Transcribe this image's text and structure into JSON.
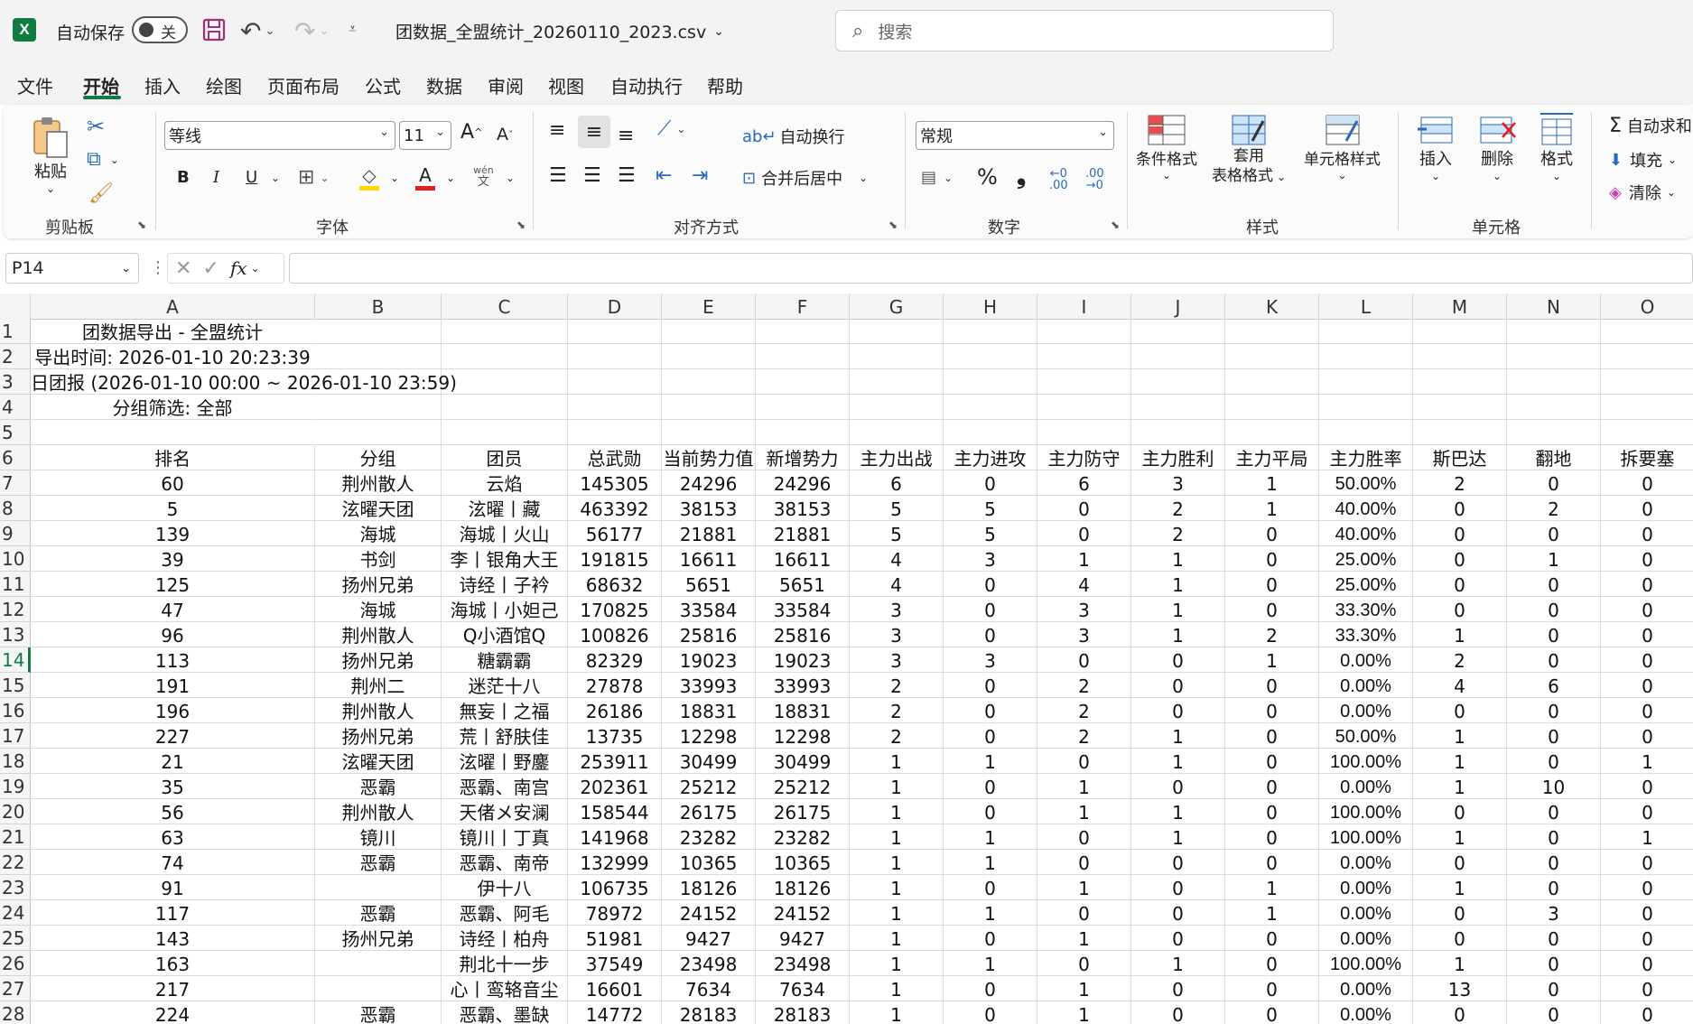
{
  "titlebar": {
    "app_icon": "X",
    "autosave_label": "自动保存",
    "autosave_state": "关",
    "filename": "团数据_全盟统计_20260110_2023.csv",
    "search_placeholder": "搜索"
  },
  "menu_tabs": [
    "文件",
    "开始",
    "插入",
    "绘图",
    "页面布局",
    "公式",
    "数据",
    "审阅",
    "视图",
    "自动执行",
    "帮助"
  ],
  "active_tab": "开始",
  "ribbon": {
    "clipboard": {
      "paste": "粘贴",
      "label": "剪贴板"
    },
    "font": {
      "name": "等线",
      "size": "11",
      "bold": "B",
      "italic": "I",
      "underline": "U",
      "wen": "wén",
      "wen2": "文",
      "label": "字体",
      "highlight_color": "#ffd700",
      "font_color": "#e02020"
    },
    "alignment": {
      "wrap": "自动换行",
      "merge": "合并后居中",
      "label": "对齐方式"
    },
    "number": {
      "format": "常规",
      "percent": "%",
      "comma": "❟",
      "label": "数字"
    },
    "styles": {
      "conditional": "条件格式",
      "table1": "套用",
      "table2": "表格格式",
      "cell_styles": "单元格样式",
      "label": "样式"
    },
    "cells": {
      "insert": "插入",
      "delete": "删除",
      "format": "格式",
      "label": "单元格"
    },
    "editing": {
      "autosum": "自动求和",
      "fill": "填充",
      "clear": "清除"
    }
  },
  "formula_bar": {
    "name_box": "P14",
    "fx": "fx",
    "formula": ""
  },
  "sheet": {
    "columns": [
      "A",
      "B",
      "C",
      "D",
      "E",
      "F",
      "G",
      "H",
      "I",
      "J",
      "K",
      "L",
      "M",
      "N",
      "O"
    ],
    "selected_row": 14,
    "title_rows": [
      {
        "row": 1,
        "text": "团数据导出 - 全盟统计"
      },
      {
        "row": 2,
        "text": "导出时间: 2026-01-10 20:23:39"
      },
      {
        "row": 3,
        "text": "日团报 (2026-01-10 00:00 ~ 2026-01-10 23:59)"
      },
      {
        "row": 4,
        "text": "分组筛选: 全部"
      },
      {
        "row": 5,
        "text": ""
      }
    ],
    "header": [
      "排名",
      "分组",
      "团员",
      "总武勋",
      "当前势力值",
      "新增势力",
      "主力出战",
      "主力进攻",
      "主力防守",
      "主力胜利",
      "主力平局",
      "主力胜率",
      "斯巴达",
      "翻地",
      "拆要塞"
    ],
    "rows": [
      [
        "60",
        "荆州散人",
        "云焰",
        "145305",
        "24296",
        "24296",
        "6",
        "0",
        "6",
        "3",
        "1",
        "50.00%",
        "2",
        "0",
        "0"
      ],
      [
        "5",
        "泫曜天团",
        "泫曜丨藏",
        "463392",
        "38153",
        "38153",
        "5",
        "5",
        "0",
        "2",
        "1",
        "40.00%",
        "0",
        "2",
        "0"
      ],
      [
        "139",
        "海城",
        "海城丨火山",
        "56177",
        "21881",
        "21881",
        "5",
        "5",
        "0",
        "2",
        "0",
        "40.00%",
        "0",
        "0",
        "0"
      ],
      [
        "39",
        "书剑",
        "李丨银角大王",
        "191815",
        "16611",
        "16611",
        "4",
        "3",
        "1",
        "1",
        "0",
        "25.00%",
        "0",
        "1",
        "0"
      ],
      [
        "125",
        "扬州兄弟",
        "诗经丨子衿",
        "68632",
        "5651",
        "5651",
        "4",
        "0",
        "4",
        "1",
        "0",
        "25.00%",
        "0",
        "0",
        "0"
      ],
      [
        "47",
        "海城",
        "海城丨小妲己",
        "170825",
        "33584",
        "33584",
        "3",
        "0",
        "3",
        "1",
        "0",
        "33.30%",
        "0",
        "0",
        "0"
      ],
      [
        "96",
        "荆州散人",
        "Q小酒馆Q",
        "100826",
        "25816",
        "25816",
        "3",
        "0",
        "3",
        "1",
        "2",
        "33.30%",
        "1",
        "0",
        "0"
      ],
      [
        "113",
        "扬州兄弟",
        "糖霸霸",
        "82329",
        "19023",
        "19023",
        "3",
        "3",
        "0",
        "0",
        "1",
        "0.00%",
        "2",
        "0",
        "0"
      ],
      [
        "191",
        "荆州二",
        "迷茫十八",
        "27878",
        "33993",
        "33993",
        "2",
        "0",
        "2",
        "0",
        "0",
        "0.00%",
        "4",
        "6",
        "0"
      ],
      [
        "196",
        "荆州散人",
        "無妄丨之福",
        "26186",
        "18831",
        "18831",
        "2",
        "0",
        "2",
        "0",
        "0",
        "0.00%",
        "0",
        "0",
        "0"
      ],
      [
        "227",
        "扬州兄弟",
        "荒丨舒肤佳",
        "13735",
        "12298",
        "12298",
        "2",
        "0",
        "2",
        "1",
        "0",
        "50.00%",
        "1",
        "0",
        "0"
      ],
      [
        "21",
        "泫曜天团",
        "泫曜丨野鏖",
        "253911",
        "30499",
        "30499",
        "1",
        "1",
        "0",
        "1",
        "0",
        "100.00%",
        "1",
        "0",
        "1"
      ],
      [
        "35",
        "恶霸",
        "恶霸、南宫",
        "202361",
        "25212",
        "25212",
        "1",
        "0",
        "1",
        "0",
        "0",
        "0.00%",
        "1",
        "10",
        "0"
      ],
      [
        "56",
        "荆州散人",
        "天偖メ安澜",
        "158544",
        "26175",
        "26175",
        "1",
        "0",
        "1",
        "1",
        "0",
        "100.00%",
        "0",
        "0",
        "0"
      ],
      [
        "63",
        "镜川",
        "镜川丨丁真",
        "141968",
        "23282",
        "23282",
        "1",
        "1",
        "0",
        "1",
        "0",
        "100.00%",
        "1",
        "0",
        "1"
      ],
      [
        "74",
        "恶霸",
        "恶霸、南帝",
        "132999",
        "10365",
        "10365",
        "1",
        "1",
        "0",
        "0",
        "0",
        "0.00%",
        "0",
        "0",
        "0"
      ],
      [
        "91",
        "",
        "伊十八",
        "106735",
        "18126",
        "18126",
        "1",
        "0",
        "1",
        "0",
        "1",
        "0.00%",
        "1",
        "0",
        "0"
      ],
      [
        "117",
        "恶霸",
        "恶霸、阿毛",
        "78972",
        "24152",
        "24152",
        "1",
        "1",
        "0",
        "0",
        "1",
        "0.00%",
        "0",
        "3",
        "0"
      ],
      [
        "143",
        "扬州兄弟",
        "诗经丨柏舟",
        "51981",
        "9427",
        "9427",
        "1",
        "0",
        "1",
        "0",
        "0",
        "0.00%",
        "0",
        "0",
        "0"
      ],
      [
        "163",
        "",
        "荆北十一步",
        "37549",
        "23498",
        "23498",
        "1",
        "1",
        "0",
        "1",
        "0",
        "100.00%",
        "1",
        "0",
        "0"
      ],
      [
        "217",
        "",
        "心丨鸾辂音尘",
        "16601",
        "7634",
        "7634",
        "1",
        "0",
        "1",
        "0",
        "0",
        "0.00%",
        "13",
        "0",
        "0"
      ],
      [
        "224",
        "恶霸",
        "恶霸、墨缺",
        "14772",
        "28183",
        "28183",
        "1",
        "0",
        "1",
        "0",
        "0",
        "0.00%",
        "0",
        "0",
        "0"
      ]
    ]
  }
}
